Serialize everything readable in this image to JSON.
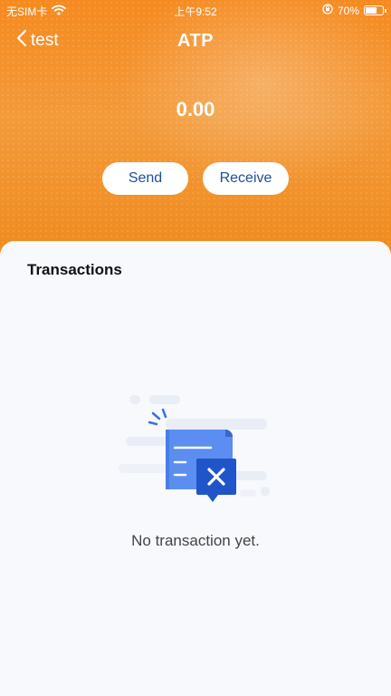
{
  "status_bar": {
    "carrier": "无SIM卡",
    "time": "上午9:52",
    "battery": "70%",
    "battery_level": 0.7
  },
  "nav": {
    "back_label": "test",
    "title": "ATP"
  },
  "wallet": {
    "balance": "0.00",
    "send_label": "Send",
    "receive_label": "Receive"
  },
  "transactions": {
    "heading": "Transactions",
    "empty_text": "No transaction yet."
  },
  "colors": {
    "header_orange": "#f58a1f",
    "button_text": "#1c4fa0",
    "illustration_blue": "#3d6fe0"
  },
  "icons": [
    "wifi-icon",
    "lock-rotation-icon",
    "battery-icon",
    "back-chevron-icon",
    "empty-receipt-icon"
  ]
}
